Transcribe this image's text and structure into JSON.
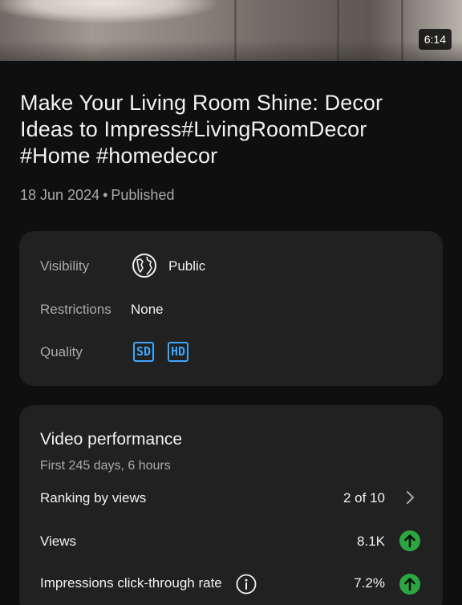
{
  "video": {
    "duration": "6:14",
    "title": "Make Your Living Room Shine: Decor Ideas to  Impress#LivingRoomDecor #Home #homedecor",
    "date": "18 Jun 2024",
    "status": "Published"
  },
  "details": {
    "visibility_label": "Visibility",
    "visibility_value": "Public",
    "restrictions_label": "Restrictions",
    "restrictions_value": "None",
    "quality_label": "Quality",
    "quality_badges": [
      "SD",
      "HD"
    ]
  },
  "performance": {
    "title": "Video performance",
    "subtitle": "First 245 days, 6 hours",
    "ranking_label": "Ranking by views",
    "ranking_value": "2 of 10",
    "views_label": "Views",
    "views_value": "8.1K",
    "ctr_label": "Impressions click-through rate",
    "ctr_value": "7.2%"
  },
  "colors": {
    "background": "#0f0f0f",
    "card": "#212121",
    "accent_blue": "#3ea6ff",
    "trend_green": "#2ba640"
  },
  "icons": [
    "globe-icon",
    "chevron-right-icon",
    "arrow-up-icon",
    "info-icon"
  ]
}
